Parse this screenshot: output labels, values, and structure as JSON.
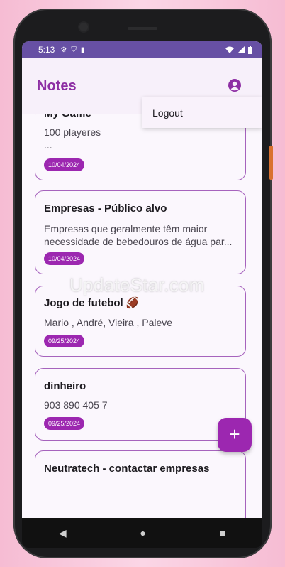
{
  "status_bar": {
    "time": "5:13"
  },
  "app_bar": {
    "title": "Notes"
  },
  "menu": {
    "items": [
      {
        "label": "Logout"
      }
    ]
  },
  "notes": [
    {
      "title": "My Game",
      "body": "100 playeres\n...",
      "date": "10/04/2024"
    },
    {
      "title": "Empresas - Público alvo",
      "body": "Empresas que geralmente têm maior necessidade de bebedouros de água par...",
      "date": "10/04/2024"
    },
    {
      "title": "Jogo de futebol 🏈",
      "body": "Mario , André, Vieira , Paleve",
      "date": "09/25/2024"
    },
    {
      "title": "dinheiro",
      "body": "903 890 405 7",
      "date": "09/25/2024"
    },
    {
      "title": "Neutratech - contactar empresas",
      "body": "",
      "date": ""
    }
  ],
  "fab": {
    "label": "+"
  },
  "watermark": "UpdateStar.com",
  "colors": {
    "primary": "#9c27b0",
    "status_bar": "#6750a4",
    "card_border": "#a663bd"
  },
  "icons": {
    "account": "account-circle-icon",
    "fab": "add-icon"
  }
}
